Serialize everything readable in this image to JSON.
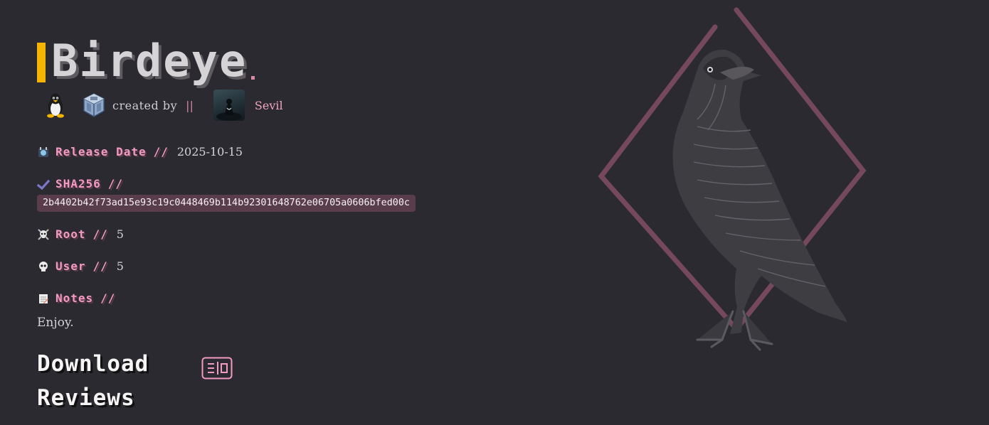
{
  "machine": {
    "title": "Birdeye",
    "created_by": "created by",
    "separator": "||",
    "author": "Sevil"
  },
  "icons": {
    "os": "linux-penguin-icon",
    "hypervisor": "virtualbox-icon",
    "release": "calendar-icon",
    "sha": "checkmark-icon",
    "root": "skull-crossbones-icon",
    "user": "skull-icon",
    "notes": "memo-icon",
    "download": "download-icon"
  },
  "fields": {
    "release_label": "Release Date",
    "release_sep": "//",
    "release_value": "2025-10-15",
    "sha_label": "SHA256",
    "sha_sep": "//",
    "sha_value": "2b4402b42f73ad15e93c19c0448469b114b92301648762e06705a0606bfed00c",
    "root_label": "Root",
    "root_sep": "//",
    "root_value": "5",
    "user_label": "User",
    "user_sep": "//",
    "user_value": "5",
    "notes_label": "Notes",
    "notes_sep": "//",
    "notes_value": "Enjoy."
  },
  "sections": {
    "download": "Download",
    "reviews": "Reviews"
  },
  "colors": {
    "background": "#2b2a30",
    "accent_yellow": "#f4b400",
    "accent_pink": "#f39ac0",
    "hash_bg": "#5a3d4b",
    "diamond": "#7a4a5e"
  }
}
